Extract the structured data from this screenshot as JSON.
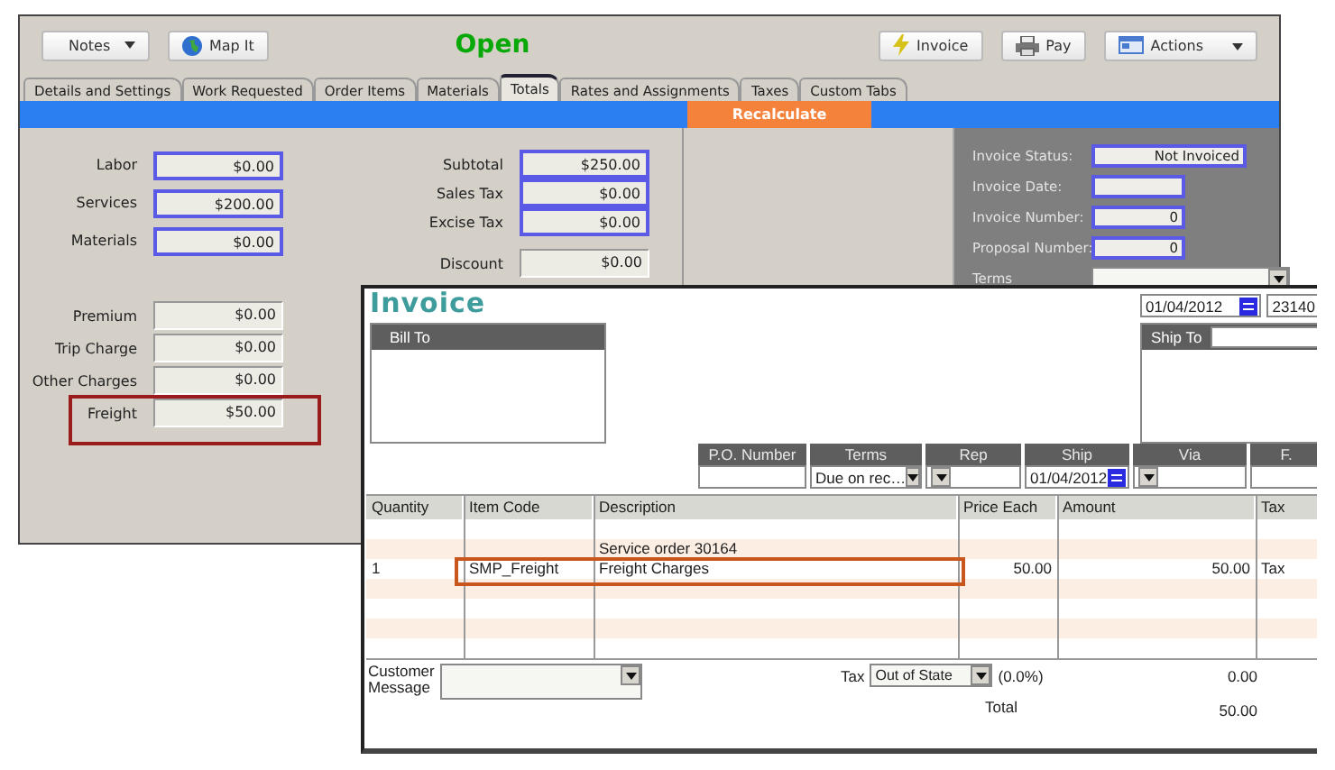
{
  "back_window": {
    "toolbar": {
      "notes_menu": "Notes",
      "map_button": "Map It",
      "status": "Open",
      "buttons": [
        {
          "label": "Invoice",
          "kind": "bolt"
        },
        {
          "label": "Pay",
          "kind": "printer"
        },
        {
          "label": "Actions",
          "kind": "menu"
        }
      ]
    },
    "tabs": [
      {
        "label": "Details and Settings",
        "selected": false
      },
      {
        "label": "Work Requested",
        "selected": false
      },
      {
        "label": "Order Items",
        "selected": false
      },
      {
        "label": "Materials",
        "selected": false
      },
      {
        "label": "Totals",
        "selected": true
      },
      {
        "label": "Rates and Assignments",
        "selected": false
      },
      {
        "label": "Taxes",
        "selected": false
      },
      {
        "label": "Custom Tabs",
        "selected": false
      }
    ],
    "recalculate_button": "Recalculate",
    "charges": [
      {
        "label": "Labor",
        "value": "$0.00",
        "kind": "bound"
      },
      {
        "label": "Services",
        "value": "$200.00",
        "kind": "bound"
      },
      {
        "label": "Materials",
        "value": "$0.00",
        "kind": "bound"
      },
      {
        "label": "Premium",
        "value": "$0.00",
        "kind": "plain"
      },
      {
        "label": "Trip Charge",
        "value": "$0.00",
        "kind": "plain"
      },
      {
        "label": "Other Charges",
        "value": "$0.00",
        "kind": "plain"
      },
      {
        "label": "Freight",
        "value": "$50.00",
        "kind": "plain",
        "highlighted": true
      }
    ],
    "totals": [
      {
        "label": "Subtotal",
        "value": "$250.00",
        "kind": "bound"
      },
      {
        "label": "Sales Tax",
        "value": "$0.00",
        "kind": "bound"
      },
      {
        "label": "Excise Tax",
        "value": "$0.00",
        "kind": "bound"
      },
      {
        "label": "Discount",
        "value": "$0.00",
        "kind": "plain"
      }
    ],
    "invoice_info": [
      {
        "label": "Invoice Status:",
        "value": "Not Invoiced"
      },
      {
        "label": "Invoice Date:"
      },
      {
        "label": "Invoice Number:",
        "value": "0"
      },
      {
        "label": "Proposal Number:",
        "value": "0"
      }
    ],
    "terms_label": "Terms"
  },
  "invoice_window": {
    "title": "Invoice",
    "date": "01/04/2012",
    "number": "23140",
    "bill_to": "Bill To",
    "ship_to": "Ship To",
    "header_fields": [
      {
        "label": "P.O. Number",
        "kind": "text"
      },
      {
        "label": "Terms",
        "value": "Due on rec…",
        "kind": "select"
      },
      {
        "label": "Rep",
        "kind": "select"
      },
      {
        "label": "Ship",
        "value": "01/04/2012",
        "kind": "date"
      },
      {
        "label": "Via",
        "kind": "select"
      },
      {
        "label": "F.",
        "kind": "text"
      }
    ],
    "columns": [
      "Quantity",
      "Item Code",
      "Description",
      "Price Each",
      "Amount",
      "Tax"
    ],
    "rows": [
      {
        "description": "Service order 30164"
      },
      {
        "quantity": "1",
        "item_code": "SMP_Freight",
        "description": "Freight Charges",
        "price_each": "50.00",
        "amount": "50.00",
        "tax": "Tax",
        "highlighted": true
      }
    ],
    "customer_message_label": "Customer Message",
    "tax_label": "Tax",
    "tax_code": "Out of State",
    "tax_rate": "(0.0%)",
    "tax_amount": "0.00",
    "total_label": "Total",
    "total": "50.00"
  }
}
